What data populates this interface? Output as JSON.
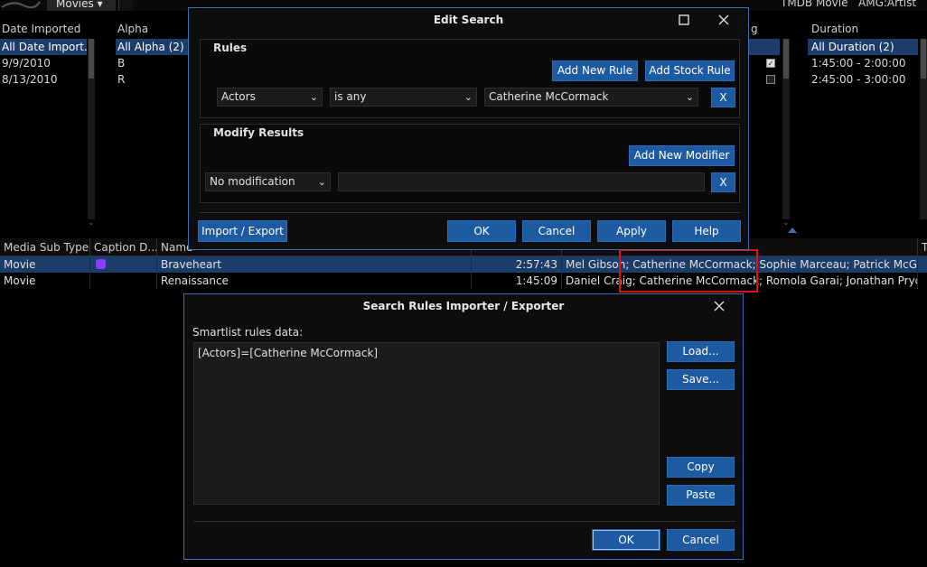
{
  "topbar": {
    "tab_movies": "Movies ▾",
    "right_headers": [
      "TMDB Movie",
      "AMG:Artist"
    ]
  },
  "filters": {
    "date_imported": {
      "header": "Date Imported",
      "items": [
        "All Date Import...",
        "9/9/2010",
        "8/13/2010"
      ]
    },
    "alpha": {
      "header": "Alpha",
      "items": [
        "All Alpha (2)",
        "B",
        "R"
      ]
    },
    "g_column": {
      "header": "g"
    },
    "duration": {
      "header": "Duration",
      "items": [
        "All Duration (2)",
        "1:45:00 - 2:00:00",
        "2:45:00 - 3:00:00"
      ]
    }
  },
  "list": {
    "columns": [
      "Media Sub Type",
      "Caption D...",
      "Name"
    ],
    "rows": [
      {
        "type": "Movie",
        "caption": "",
        "name": "Braveheart",
        "duration": "2:57:43",
        "actors": "Mel Gibson; Catherine McCormack; Sophie Marceau; Patrick McGooha..."
      },
      {
        "type": "Movie",
        "caption": "",
        "name": "Renaissance",
        "duration": "1:45:09",
        "actors": "Daniel Craig; Catherine McCormack; Romola Garai; Jonathan Pryce"
      }
    ]
  },
  "edit_search": {
    "title": "Edit Search",
    "rules_title": "Rules",
    "add_new_rule": "Add New Rule",
    "add_stock_rule": "Add Stock Rule",
    "rule_field": "Actors",
    "rule_operator": "is any",
    "rule_value": "Catherine McCormack",
    "remove_label": "X",
    "modify_title": "Modify Results",
    "add_new_modifier": "Add New Modifier",
    "modifier_value": "No modification",
    "import_export": "Import / Export",
    "ok": "OK",
    "cancel": "Cancel",
    "apply": "Apply",
    "help": "Help"
  },
  "importer": {
    "title": "Search Rules Importer / Exporter",
    "label": "Smartlist rules data:",
    "data": "[Actors]=[Catherine McCormack]",
    "load": "Load...",
    "save": "Save...",
    "copy": "Copy",
    "paste": "Paste",
    "ok": "OK",
    "cancel": "Cancel"
  },
  "colors": {
    "selection": "#1c3d6a",
    "button": "#1e5aa0",
    "dialog_border": "#3f6fb0",
    "highlight": "#e01010",
    "caption_icon": "#8a3cff"
  }
}
